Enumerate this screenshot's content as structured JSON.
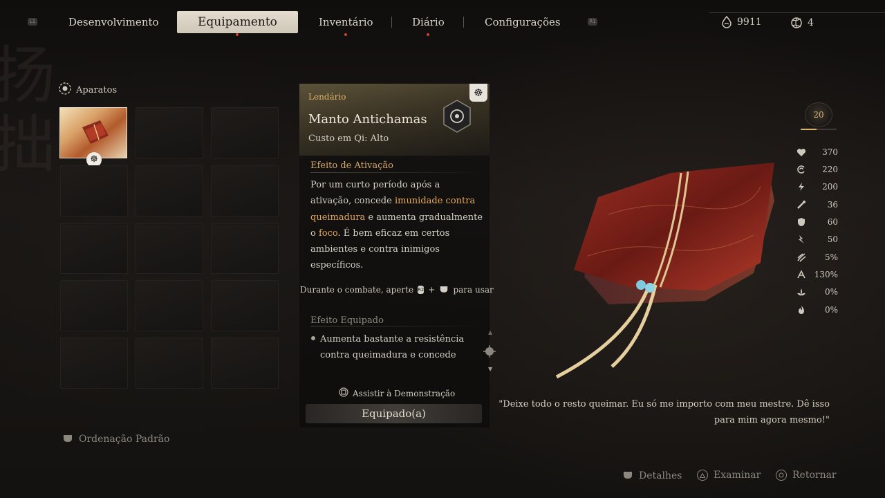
{
  "topbar": {
    "left_trigger": "L1",
    "right_trigger": "R1",
    "tabs": [
      {
        "label": "Desenvolvimento"
      },
      {
        "label": "Equipamento"
      },
      {
        "label": "Inventário"
      },
      {
        "label": "Diário"
      },
      {
        "label": "Configurações"
      }
    ],
    "currency": [
      {
        "icon": "will-droplet-icon",
        "value": "9911"
      },
      {
        "icon": "spark-swirl-icon",
        "value": "4"
      }
    ]
  },
  "left_panel": {
    "section_title": "Aparatos",
    "section_icon": "vessel-gear-icon",
    "sort_label": "Ordenação Padrão"
  },
  "card": {
    "rarity": "Lendário",
    "item_name": "Manto Antichamas",
    "qi_cost": "Custo em Qi: Alto",
    "activation_title": "Efeito de Ativação",
    "activation_text": {
      "p1": "Por um curto período após a ativação, concede ",
      "h1": "imunidade contra queimadura",
      "p2": " e aumenta gradualmente o ",
      "h2": "foco",
      "p3": ". É bem eficaz em certos ambientes e contra inimigos específicos."
    },
    "combat_hint": {
      "before": "Durante o combate, aperte",
      "key1": "R2",
      "plus": "+",
      "after": "para usar"
    },
    "equipped_effect_title": "Efeito Equipado",
    "equipped_effect_text": "Aumenta bastante a resistência contra queimadura e concede",
    "demo_hint": "Assistir à Demonstração",
    "equipped_button": "Equipado(a)"
  },
  "level": {
    "value": "20",
    "progress": 0.45
  },
  "stats": [
    {
      "icon": "heart-icon",
      "value": "370"
    },
    {
      "icon": "mana-swirl-icon",
      "value": "220"
    },
    {
      "icon": "stamina-bolt-icon",
      "value": "200"
    },
    {
      "icon": "staff-attack-icon",
      "value": "36"
    },
    {
      "icon": "shield-defense-icon",
      "value": "60"
    },
    {
      "icon": "lightning-icon",
      "value": "50"
    },
    {
      "icon": "crit-claw-icon",
      "value": "5%"
    },
    {
      "icon": "crit-damage-icon",
      "value": "130%"
    },
    {
      "icon": "lotus-icon",
      "value": "0%"
    },
    {
      "icon": "flame-resist-icon",
      "value": "0%"
    }
  ],
  "quote": "\"Deixe todo o resto queimar. Eu só me importo com meu mestre. Dê isso para mim agora mesmo!\"",
  "bottom_prompts": [
    {
      "icon": "touchpad-icon",
      "label": "Detalhes"
    },
    {
      "icon": "triangle-button-icon",
      "label": "Examinar"
    },
    {
      "icon": "circle-button-icon",
      "label": "Retornar"
    }
  ]
}
